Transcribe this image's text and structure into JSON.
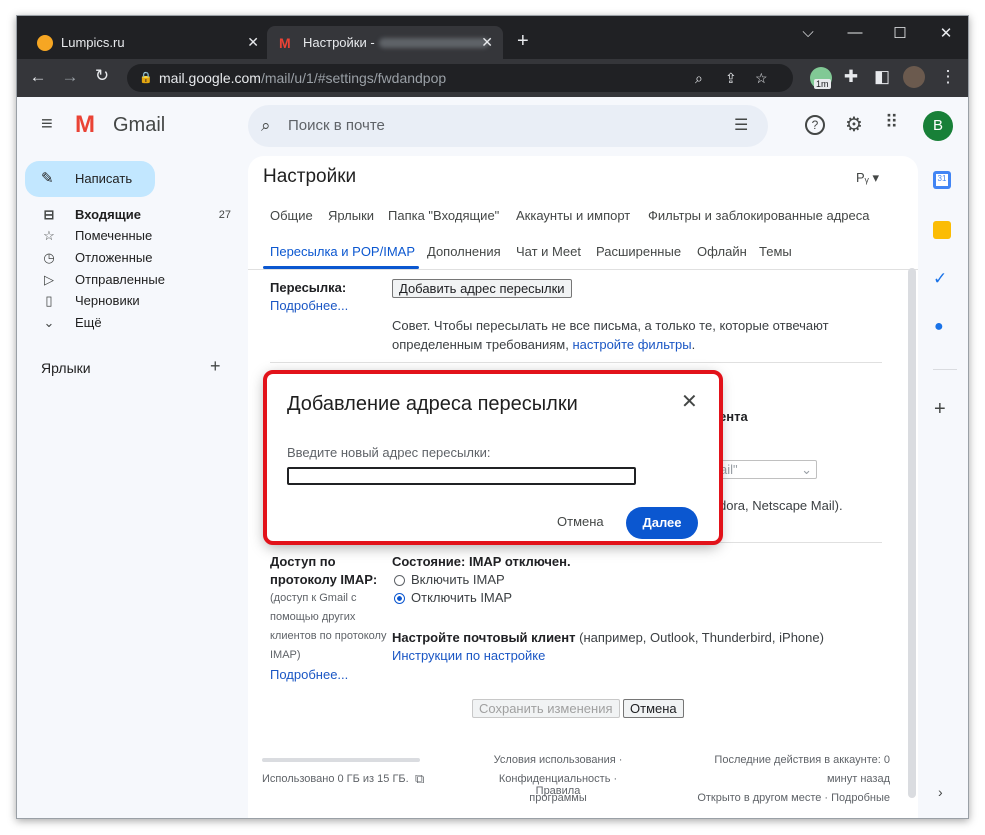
{
  "browser": {
    "tabs": [
      {
        "title": "Lumpics.ru",
        "active": false,
        "favicon_color": "#f6a623"
      },
      {
        "title": "Настройки - ",
        "active": true,
        "favicon_color": "#ea4335"
      }
    ],
    "new_tab": "+",
    "url_host": "mail.google.com",
    "url_path": "/mail/u/1/#settings/fwdandpop",
    "extension_badge": "1m"
  },
  "gmail": {
    "logo_text": "Gmail",
    "search_placeholder": "Поиск в почте",
    "avatar_letter": "B",
    "avatar_color": "#188038",
    "compose": "Написать",
    "nav": [
      {
        "label": "Входящие",
        "count": "27",
        "icon": "inbox-icon",
        "bold": true
      },
      {
        "label": "Помеченные",
        "count": "",
        "icon": "star-icon",
        "bold": false
      },
      {
        "label": "Отложенные",
        "count": "",
        "icon": "clock-icon",
        "bold": false
      },
      {
        "label": "Отправленные",
        "count": "",
        "icon": "send-icon",
        "bold": false
      },
      {
        "label": "Черновики",
        "count": "",
        "icon": "draft-icon",
        "bold": false
      },
      {
        "label": "Ещё",
        "count": "",
        "icon": "chevron-down-icon",
        "bold": false
      }
    ],
    "labels_heading": "Ярлыки",
    "labels_add": "+"
  },
  "settings": {
    "title": "Настройки",
    "lang_selector": "Рᵧ ▾",
    "tabs_row1": [
      "Общие",
      "Ярлыки",
      "Папка \"Входящие\"",
      "Аккаунты и импорт",
      "Фильтры и заблокированные адреса"
    ],
    "tabs_row2": [
      "Пересылка и POP/IMAP",
      "Дополнения",
      "Чат и Meet",
      "Расширенные",
      "Офлайн",
      "Темы"
    ],
    "forwarding_label": "Пересылка:",
    "more_link": "Подробнее...",
    "add_forward_button": "Добавить адрес пересылки",
    "tip_line1": "Совет. Чтобы пересылать не все письма, а только те, которые отвечают",
    "tip_line2": "определенным требованиям, ",
    "tip_link": "настройте фильтры",
    "tip_end": ".",
    "partial_heading": "ента",
    "partial_select": "ail\"",
    "partial_clients": "dora, Netscape Mail).",
    "imap_label_line1": "Доступ по",
    "imap_label_line2": "протоколу IMAP:",
    "imap_sub": [
      "(доступ к Gmail с",
      "помощью других",
      "клиентов по протоколу",
      "IMAP)"
    ],
    "imap_more": "Подробнее...",
    "imap_status": "Состояние: IMAP отключен.",
    "imap_enable": "Включить IMAP",
    "imap_disable": "Отключить IMAP",
    "client_bold": "Настройте почтовый клиент",
    "client_rest": " (например, Outlook, Thunderbird, iPhone)",
    "client_link": "Инструкции по настройке",
    "save_button": "Сохранить изменения",
    "cancel_button": "Отмена",
    "footer_storage": "Использовано 0 ГБ из 15 ГБ.",
    "footer_center": [
      "Условия использования ·",
      "Конфиденциальность · Правила",
      "программы"
    ],
    "footer_right": [
      "Последние действия в аккаунте: 0",
      "минут назад",
      "Открыто в другом месте · Подробные"
    ]
  },
  "dialog": {
    "title": "Добавление адреса пересылки",
    "prompt": "Введите новый адрес пересылки:",
    "input_value": "",
    "cancel": "Отмена",
    "next": "Далее",
    "accent": "#0b57d0",
    "highlight": "#e2121a"
  }
}
